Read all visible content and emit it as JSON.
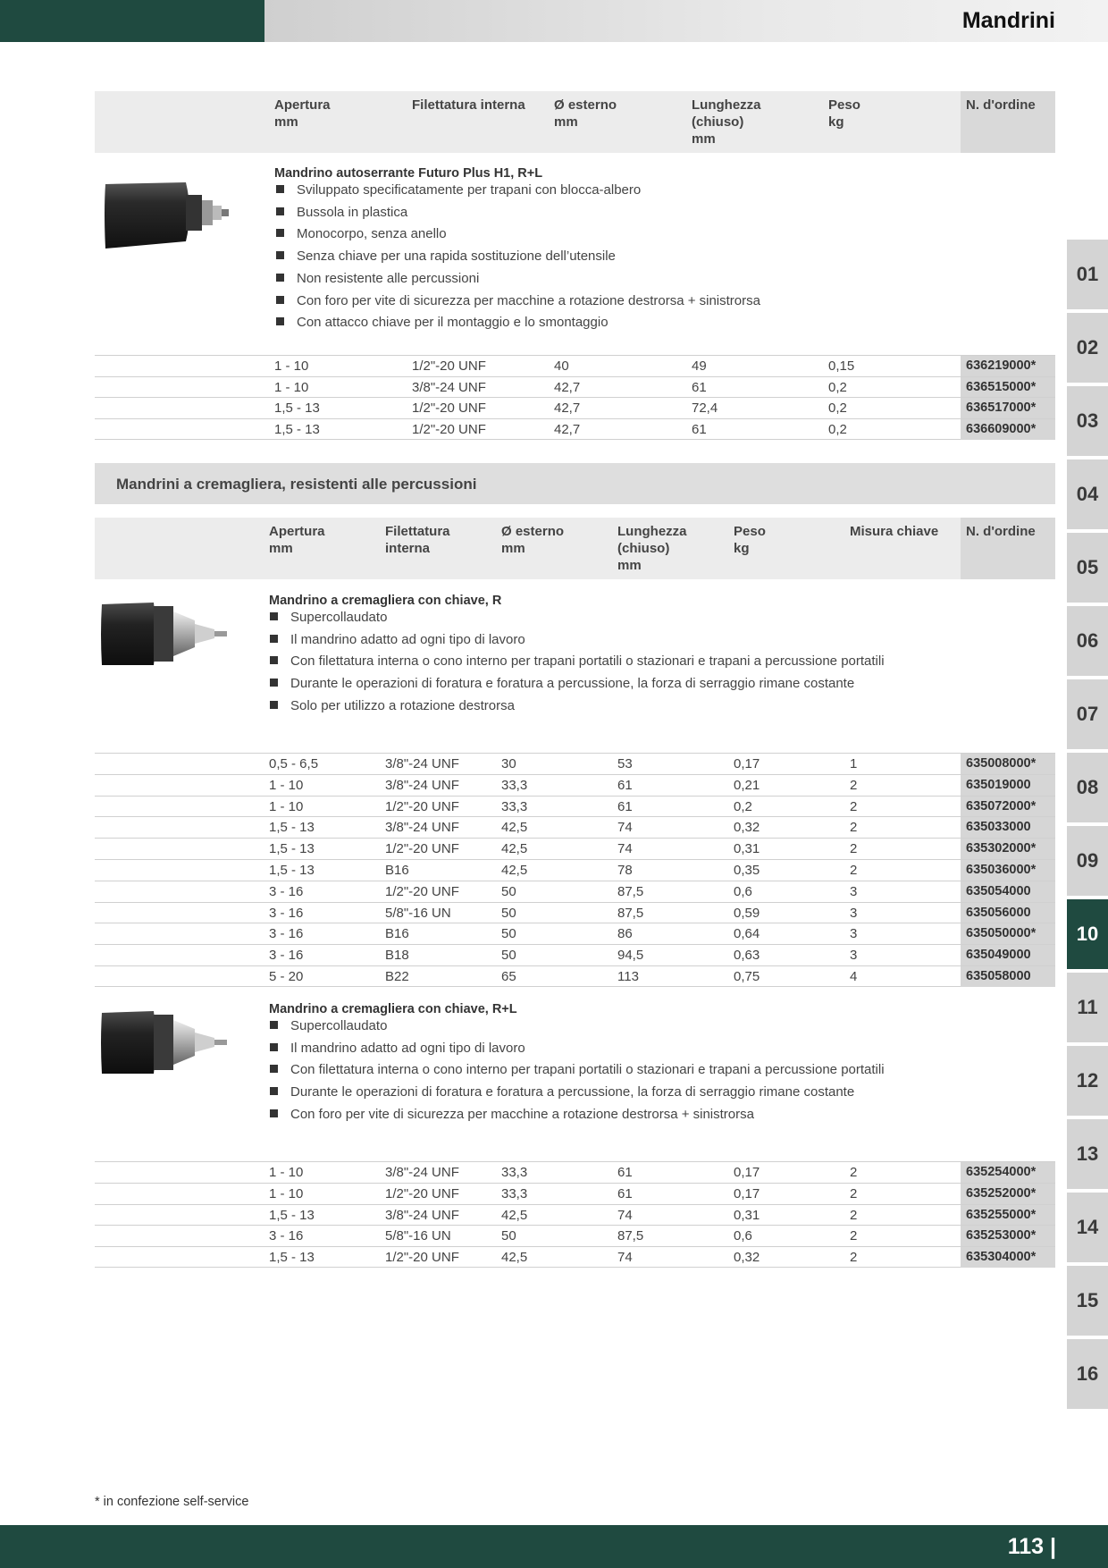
{
  "header": {
    "title": "Mandrini"
  },
  "tabs": [
    {
      "label": "01",
      "active": false
    },
    {
      "label": "02",
      "active": false
    },
    {
      "label": "03",
      "active": false
    },
    {
      "label": "04",
      "active": false
    },
    {
      "label": "05",
      "active": false
    },
    {
      "label": "06",
      "active": false
    },
    {
      "label": "07",
      "active": false
    },
    {
      "label": "08",
      "active": false
    },
    {
      "label": "09",
      "active": false
    },
    {
      "label": "10",
      "active": true
    },
    {
      "label": "11",
      "active": false
    },
    {
      "label": "12",
      "active": false
    },
    {
      "label": "13",
      "active": false
    },
    {
      "label": "14",
      "active": false
    },
    {
      "label": "15",
      "active": false
    },
    {
      "label": "16",
      "active": false
    }
  ],
  "table1": {
    "headers": [
      "Apertura\nmm",
      "Filettatura interna",
      "Ø esterno\nmm",
      "Lunghezza\n(chiuso)\nmm",
      "Peso\nkg",
      "N. d'ordine"
    ],
    "product": {
      "title": "Mandrino autoserrante Futuro Plus H1, R+L",
      "features": [
        "Sviluppato specificatamente per trapani con blocca-albero",
        "Bussola in plastica",
        "Monocorpo, senza anello",
        "Senza chiave per una rapida sostituzione dell’utensile",
        "Non resistente alle percussioni",
        "Con foro per vite di sicurezza per macchine a rotazione destrorsa + sinistrorsa",
        "Con attacco chiave per il montaggio e lo smontaggio"
      ],
      "rows": [
        [
          "1 - 10",
          "1/2\"-20 UNF",
          "40",
          "49",
          "0,15",
          "636219000*"
        ],
        [
          "1 - 10",
          "3/8\"-24 UNF",
          "42,7",
          "61",
          "0,2",
          "636515000*"
        ],
        [
          "1,5 - 13",
          "1/2\"-20 UNF",
          "42,7",
          "72,4",
          "0,2",
          "636517000*"
        ],
        [
          "1,5 - 13",
          "1/2\"-20 UNF",
          "42,7",
          "61",
          "0,2",
          "636609000*"
        ]
      ]
    }
  },
  "section2": {
    "title": "Mandrini a cremagliera, resistenti alle percussioni",
    "headers": [
      "Apertura\nmm",
      "Filettatura\ninterna",
      "Ø esterno\nmm",
      "Lunghezza\n(chiuso)\nmm",
      "Peso\nkg",
      "Misura chiave",
      "N. d'ordine"
    ],
    "products": [
      {
        "title": "Mandrino a cremagliera con chiave, R",
        "features": [
          "Supercollaudato",
          "Il mandrino adatto ad ogni tipo di lavoro",
          "Con filettatura interna o cono interno per trapani portatili o stazionari e trapani a percussione portatili",
          "Durante le operazioni di foratura e foratura a percussione, la forza di serraggio rimane costante",
          "Solo per utilizzo a rotazione destrorsa"
        ],
        "rows": [
          [
            "0,5 - 6,5",
            "3/8\"-24 UNF",
            "30",
            "53",
            "0,17",
            "1",
            "635008000*"
          ],
          [
            "1 - 10",
            "3/8\"-24 UNF",
            "33,3",
            "61",
            "0,21",
            "2",
            "635019000"
          ],
          [
            "1 - 10",
            "1/2\"-20 UNF",
            "33,3",
            "61",
            "0,2",
            "2",
            "635072000*"
          ],
          [
            "1,5 - 13",
            "3/8\"-24 UNF",
            "42,5",
            "74",
            "0,32",
            "2",
            "635033000"
          ],
          [
            "1,5 - 13",
            "1/2\"-20 UNF",
            "42,5",
            "74",
            "0,31",
            "2",
            "635302000*"
          ],
          [
            "1,5 - 13",
            "B16",
            "42,5",
            "78",
            "0,35",
            "2",
            "635036000*"
          ],
          [
            "3 - 16",
            "1/2\"-20 UNF",
            "50",
            "87,5",
            "0,6",
            "3",
            "635054000"
          ],
          [
            "3 - 16",
            "5/8\"-16 UN",
            "50",
            "87,5",
            "0,59",
            "3",
            "635056000"
          ],
          [
            "3 - 16",
            "B16",
            "50",
            "86",
            "0,64",
            "3",
            "635050000*"
          ],
          [
            "3 - 16",
            "B18",
            "50",
            "94,5",
            "0,63",
            "3",
            "635049000"
          ],
          [
            "5 - 20",
            "B22",
            "65",
            "113",
            "0,75",
            "4",
            "635058000"
          ]
        ]
      },
      {
        "title": "Mandrino a cremagliera con chiave, R+L",
        "features": [
          "Supercollaudato",
          "Il mandrino adatto ad ogni tipo di lavoro",
          "Con filettatura interna o cono interno per trapani portatili o stazionari e trapani a percussione portatili",
          "Durante le operazioni di foratura e foratura a percussione, la forza di serraggio rimane costante",
          "Con foro per vite di sicurezza per macchine a rotazione destrorsa + sinistrorsa"
        ],
        "rows": [
          [
            "1 - 10",
            "3/8\"-24 UNF",
            "33,3",
            "61",
            "0,17",
            "2",
            "635254000*"
          ],
          [
            "1 - 10",
            "1/2\"-20 UNF",
            "33,3",
            "61",
            "0,17",
            "2",
            "635252000*"
          ],
          [
            "1,5 - 13",
            "3/8\"-24 UNF",
            "42,5",
            "74",
            "0,31",
            "2",
            "635255000*"
          ],
          [
            "3 - 16",
            "5/8\"-16 UN",
            "50",
            "87,5",
            "0,6",
            "2",
            "635253000*"
          ],
          [
            "1,5 - 13",
            "1/2\"-20 UNF",
            "42,5",
            "74",
            "0,32",
            "2",
            "635304000*"
          ]
        ]
      }
    ]
  },
  "footnote": "* in confezione self-service",
  "page_number": "113 |",
  "colors": {
    "brand_dark_green": "#1f4a40",
    "band_gray": "#ececec",
    "order_gray": "#d6d6d6"
  }
}
